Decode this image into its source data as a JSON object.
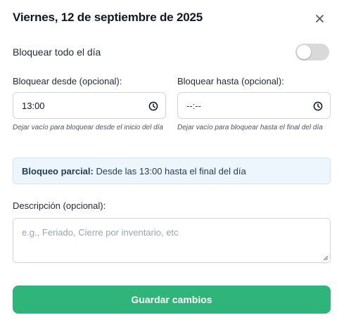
{
  "dialog": {
    "title": "Viernes, 12 de septiembre de 2025",
    "close_icon": "close-icon"
  },
  "block_all_day": {
    "label": "Bloquear todo el día",
    "enabled": false
  },
  "from": {
    "label": "Bloquear desde (opcional):",
    "value": "13:00",
    "icon": "clock-icon",
    "hint": "Dejar vacío para bloquear desde el inicio del día"
  },
  "to": {
    "label": "Bloquear hasta (opcional):",
    "value": "--:--",
    "icon": "clock-icon",
    "hint": "Dejar vacío para bloquear hasta el final del día"
  },
  "info": {
    "strong": "Bloqueo parcial:",
    "text": " Desde las 13:00 hasta el final del día"
  },
  "description": {
    "label": "Descripción (opcional):",
    "placeholder": "e.g., Feriado, Cierre por inventario, etc"
  },
  "save_button": {
    "label": "Guardar cambios",
    "color": "#2fb57a"
  }
}
